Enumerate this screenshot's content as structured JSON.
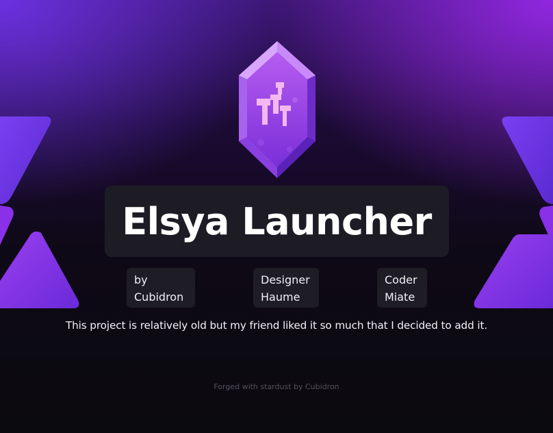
{
  "title": "Elsya Launcher",
  "credits": [
    {
      "line1": "by",
      "line2": "Cubidron"
    },
    {
      "line1": "Designer",
      "line2": "Haume"
    },
    {
      "line1": "Coder",
      "line2": "Miate"
    }
  ],
  "description": "This project is relatively old but my friend liked it so much that I decided to add it.",
  "footer": "Forged with stardust by Cubidron",
  "logo_icon": "purple-crystal-gem-icon",
  "colors": {
    "accent_purple": "#8b3ff0",
    "accent_violet": "#6d3ce6",
    "card_bg": "#1d1c25",
    "page_bg": "#0b0a0e"
  }
}
